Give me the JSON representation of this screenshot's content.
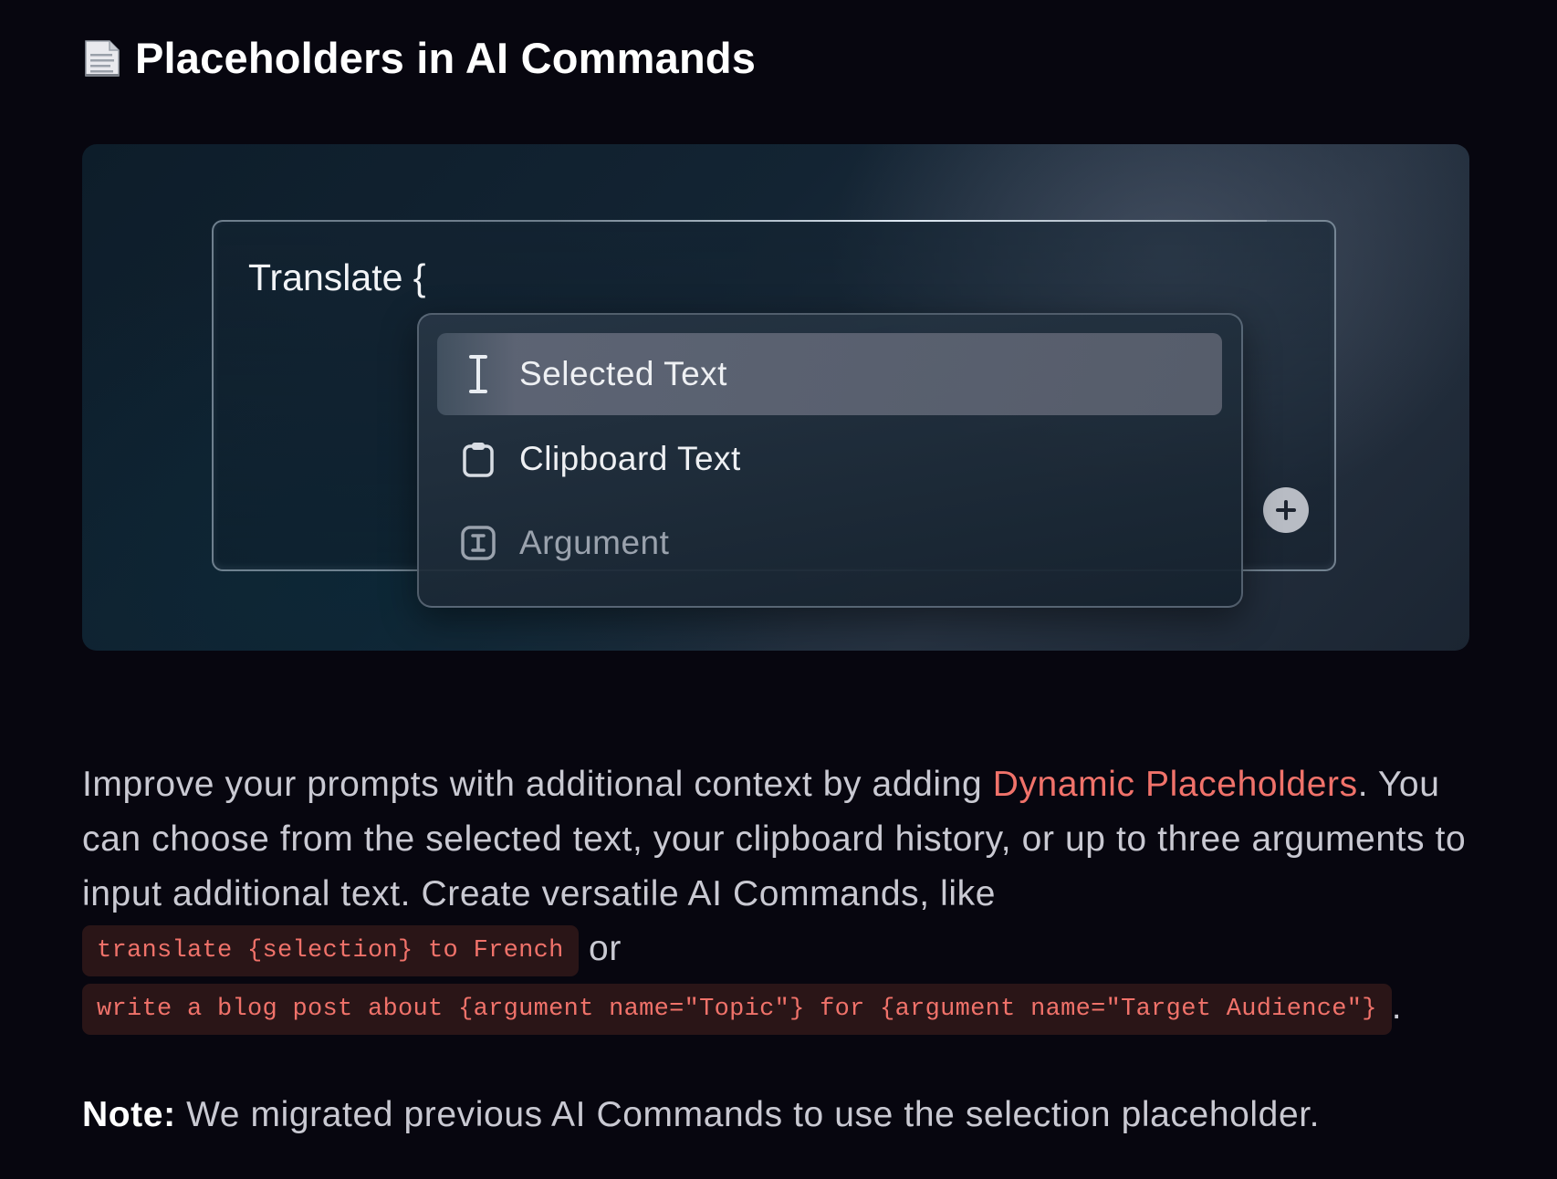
{
  "heading": {
    "icon": "page-facing-up-icon",
    "title": "Placeholders in AI Commands"
  },
  "illustration": {
    "editor_text": "Translate {",
    "menu": {
      "items": [
        {
          "label": "Selected Text",
          "icon": "text-cursor-icon",
          "selected": true
        },
        {
          "label": "Clipboard Text",
          "icon": "clipboard-icon",
          "selected": false
        },
        {
          "label": "Argument",
          "icon": "argument-icon",
          "selected": false
        }
      ]
    },
    "add_button_icon": "plus-icon"
  },
  "body": {
    "intro": "Improve your prompts with additional context by adding ",
    "link_text": "Dynamic Placeholders",
    "after_link": ". You can choose from the selected text, your clipboard history, or up to three arguments to input additional text. Create versatile AI Commands, like ",
    "code_1": "translate {selection} to French",
    "between_codes": " or",
    "code_2": "write a blog post about {argument name=\"Topic\"} for {argument name=\"Target Audience\"}",
    "ending": "."
  },
  "note": {
    "label": "Note:",
    "text": " We migrated previous AI Commands to use the selection placeholder."
  },
  "colors": {
    "background": "#07060f",
    "accent_link": "#f0726a",
    "code_background": "#2a1517"
  }
}
